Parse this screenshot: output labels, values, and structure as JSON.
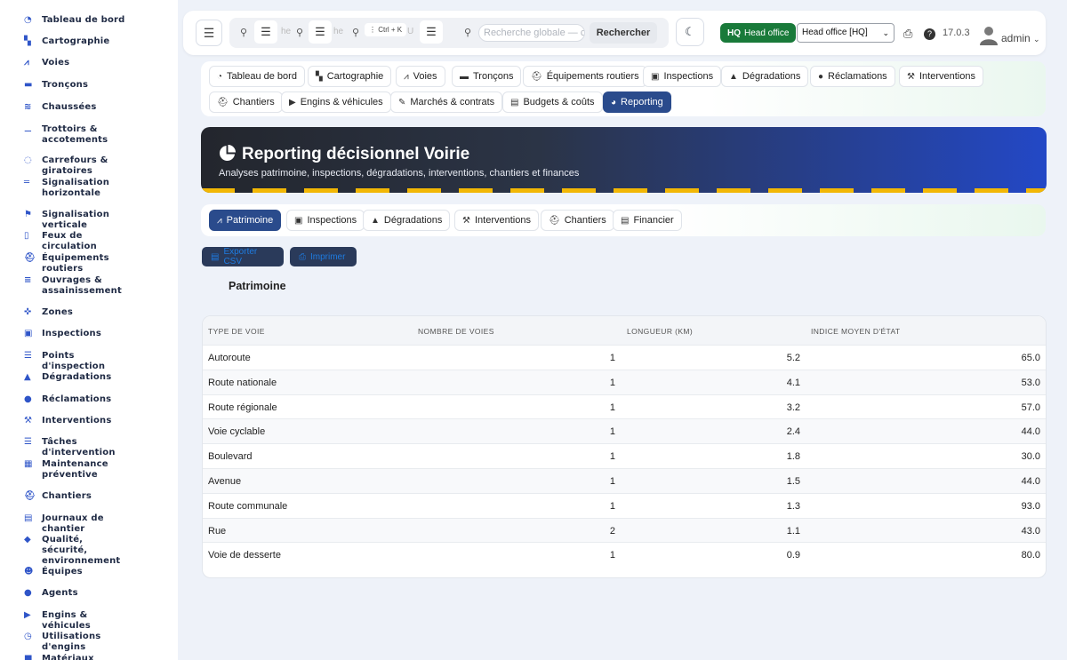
{
  "sidebar": {
    "items": [
      {
        "icon": "dashboard-icon",
        "glyph": "◔",
        "label": "Tableau de bord"
      },
      {
        "icon": "map-icon",
        "glyph": "▚",
        "label": "Cartographie"
      },
      {
        "icon": "road-icon",
        "glyph": "⩘",
        "label": "Voies"
      },
      {
        "icon": "segment-icon",
        "glyph": "▬",
        "label": "Tronçons"
      },
      {
        "icon": "layers-icon",
        "glyph": "≋",
        "label": "Chaussées"
      },
      {
        "icon": "walk-icon",
        "glyph": "⚊",
        "label": "Trottoirs & accotements"
      },
      {
        "icon": "roundabout-icon",
        "glyph": "◌",
        "label": "Carrefours & giratoires"
      },
      {
        "icon": "marking-icon",
        "glyph": "═",
        "label": "Signalisation horizontale"
      },
      {
        "icon": "sign-icon",
        "glyph": "⚑",
        "label": "Signalisation verticale"
      },
      {
        "icon": "traffic-light-icon",
        "glyph": "▯",
        "label": "Feux de circulation"
      },
      {
        "icon": "equipment-icon",
        "glyph": "⛑",
        "label": "Équipements routiers"
      },
      {
        "icon": "bridge-icon",
        "glyph": "≡",
        "label": "Ouvrages & assainissement"
      },
      {
        "icon": "zones-icon",
        "glyph": "✜",
        "label": "Zones"
      },
      {
        "icon": "clipboard-check-icon",
        "glyph": "▣",
        "label": "Inspections"
      },
      {
        "icon": "list-icon",
        "glyph": "☰",
        "label": "Points d'inspection"
      },
      {
        "icon": "warning-icon",
        "glyph": "▲",
        "label": "Dégradations"
      },
      {
        "icon": "comment-icon",
        "glyph": "●",
        "label": "Réclamations"
      },
      {
        "icon": "wrench-icon",
        "glyph": "⚒",
        "label": "Interventions"
      },
      {
        "icon": "tasks-icon",
        "glyph": "☰",
        "label": "Tâches d'intervention"
      },
      {
        "icon": "calendar-check-icon",
        "glyph": "▦",
        "label": "Maintenance préventive"
      },
      {
        "icon": "helmet-icon",
        "glyph": "⛑",
        "label": "Chantiers"
      },
      {
        "icon": "book-icon",
        "glyph": "▤",
        "label": "Journaux de chantier"
      },
      {
        "icon": "shield-icon",
        "glyph": "◆",
        "label": "Qualité, sécurité, environnement"
      },
      {
        "icon": "users-icon",
        "glyph": "☻",
        "label": "Équipes"
      },
      {
        "icon": "user-icon",
        "glyph": "●",
        "label": "Agents"
      },
      {
        "icon": "truck-icon",
        "glyph": "▶",
        "label": "Engins & véhicules"
      },
      {
        "icon": "clock-icon",
        "glyph": "◷",
        "label": "Utilisations d'engins"
      },
      {
        "icon": "box-icon",
        "glyph": "■",
        "label": "Matériaux"
      }
    ]
  },
  "header": {
    "search_placeholder_1": "he",
    "search_placeholder_2": "he",
    "search_placeholder_3": "U",
    "kbd_hint": "Ctrl + K",
    "global_search_placeholder": "Recherche globale — c",
    "search_button": "Rechercher",
    "hq_badge_code": "HQ",
    "hq_badge_label": "Head office",
    "office_select": "Head office [HQ]",
    "version": "17.0.3",
    "user": "admin"
  },
  "modules": [
    {
      "icon": "dashboard-icon",
      "glyph": "◔",
      "label": "Tableau de bord"
    },
    {
      "icon": "map-icon",
      "glyph": "▚",
      "label": "Cartographie"
    },
    {
      "icon": "road-icon",
      "glyph": "⩘",
      "label": "Voies"
    },
    {
      "icon": "segment-icon",
      "glyph": "▬",
      "label": "Tronçons"
    },
    {
      "icon": "equipment-icon",
      "glyph": "⛑",
      "label": "Équipements routiers"
    },
    {
      "icon": "clipboard-check-icon",
      "glyph": "▣",
      "label": "Inspections"
    },
    {
      "icon": "warning-icon",
      "glyph": "▲",
      "label": "Dégradations"
    },
    {
      "icon": "comment-icon",
      "glyph": "●",
      "label": "Réclamations"
    },
    {
      "icon": "wrench-icon",
      "glyph": "⚒",
      "label": "Interventions"
    },
    {
      "icon": "helmet-icon",
      "glyph": "⛑",
      "label": "Chantiers"
    },
    {
      "icon": "truck-icon",
      "glyph": "▶",
      "label": "Engins & véhicules"
    },
    {
      "icon": "contract-icon",
      "glyph": "✎",
      "label": "Marchés & contrats"
    },
    {
      "icon": "money-icon",
      "glyph": "▤",
      "label": "Budgets & coûts"
    },
    {
      "icon": "pie-chart-icon",
      "glyph": "◕",
      "label": "Reporting",
      "active": true
    }
  ],
  "banner": {
    "title": "Reporting décisionnel Voirie",
    "subtitle": "Analyses patrimoine, inspections, dégradations, interventions, chantiers et finances"
  },
  "report_tabs": [
    {
      "icon": "road-icon",
      "glyph": "⩘",
      "label": "Patrimoine",
      "active": true
    },
    {
      "icon": "clipboard-check-icon",
      "glyph": "▣",
      "label": "Inspections"
    },
    {
      "icon": "warning-icon",
      "glyph": "▲",
      "label": "Dégradations"
    },
    {
      "icon": "wrench-icon",
      "glyph": "⚒",
      "label": "Interventions"
    },
    {
      "icon": "helmet-icon",
      "glyph": "⛑",
      "label": "Chantiers"
    },
    {
      "icon": "money-icon",
      "glyph": "▤",
      "label": "Financier"
    }
  ],
  "actions": {
    "export_csv": "Exporter CSV",
    "print": "Imprimer"
  },
  "section_title": "Patrimoine",
  "table": {
    "columns": [
      "Type de voie",
      "Nombre de voies",
      "Longueur (km)",
      "Indice moyen d'état"
    ],
    "rows": [
      [
        "Autoroute",
        "1",
        "5.2",
        "65.0"
      ],
      [
        "Route nationale",
        "1",
        "4.1",
        "53.0"
      ],
      [
        "Route régionale",
        "1",
        "3.2",
        "57.0"
      ],
      [
        "Voie cyclable",
        "1",
        "2.4",
        "44.0"
      ],
      [
        "Boulevard",
        "1",
        "1.8",
        "30.0"
      ],
      [
        "Avenue",
        "1",
        "1.5",
        "44.0"
      ],
      [
        "Route communale",
        "1",
        "1.3",
        "93.0"
      ],
      [
        "Rue",
        "2",
        "1.1",
        "43.0"
      ],
      [
        "Voie de desserte",
        "1",
        "0.9",
        "80.0"
      ]
    ]
  },
  "colors": {
    "accent": "#2a4b8c",
    "hq_green": "#197a3a",
    "stripe_yellow": "#f2b705"
  }
}
